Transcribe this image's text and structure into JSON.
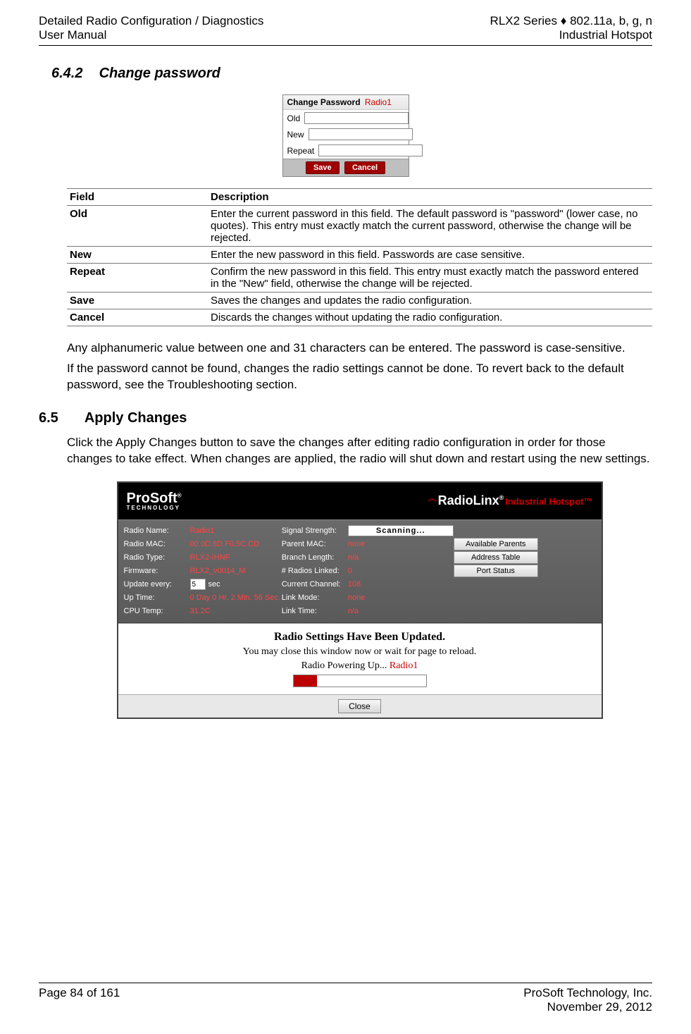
{
  "header": {
    "left_top": "Detailed Radio Configuration / Diagnostics",
    "left_bottom": "User Manual",
    "right_top": "RLX2 Series ♦ 802.11a, b, g, n",
    "right_bottom": "Industrial Hotspot"
  },
  "section_642": {
    "number": "6.4.2",
    "title": "Change password",
    "dialog": {
      "title": "Change Password",
      "radio_name": "Radio1",
      "rows": {
        "old": "Old",
        "new": "New",
        "repeat": "Repeat"
      },
      "buttons": {
        "save": "Save",
        "cancel": "Cancel"
      }
    },
    "table": {
      "head_field": "Field",
      "head_desc": "Description",
      "rows": [
        {
          "field": "Old",
          "desc": "Enter the current password in this field. The default password is \"password\" (lower case, no quotes). This entry must exactly match the current password, otherwise the change will be rejected."
        },
        {
          "field": "New",
          "desc": "Enter the new password in this field. Passwords are case sensitive."
        },
        {
          "field": "Repeat",
          "desc": "Confirm the new password in this field. This entry must exactly match the password entered in the \"New\" field, otherwise the change will be rejected."
        },
        {
          "field": "Save",
          "desc": "Saves the changes and updates the radio configuration."
        },
        {
          "field": "Cancel",
          "desc": "Discards the changes without updating the radio configuration."
        }
      ]
    },
    "para1": "Any alphanumeric value between one and 31 characters can be entered. The password is case-sensitive.",
    "para2": "If the password cannot be found, changes the radio settings cannot be done. To revert back to the default password, see the Troubleshooting section."
  },
  "section_65": {
    "number": "6.5",
    "title": "Apply Changes",
    "para": "Click the Apply Changes button to save the changes after editing radio configuration in order for those changes to take effect. When changes are applied, the radio will shut down and restart using the new settings.",
    "panel": {
      "logo": "ProSoft",
      "logo_sub": "TECHNOLOGY",
      "brand": "RadioLinx",
      "brand_tag": "Industrial Hotspot™",
      "col1": [
        {
          "label": "Radio Name:",
          "value": "Radio1"
        },
        {
          "label": "Radio MAC:",
          "value": "00.0D.8D.F0.5C.CD"
        },
        {
          "label": "Radio Type:",
          "value": "RLX2-IHNF"
        },
        {
          "label": "Firmware:",
          "value": "RLX2_v0014_M"
        },
        {
          "label": "Update every:",
          "value": "5",
          "suffix": "sec",
          "input": true
        },
        {
          "label": "Up Time:",
          "value": "0 Day 0 Hr. 2 Min. 56 Sec."
        },
        {
          "label": "CPU Temp:",
          "value": "31.2C"
        }
      ],
      "col2": [
        {
          "label": "Signal Strength:",
          "scan": "Scanning..."
        },
        {
          "label": "Parent MAC:",
          "value": "none"
        },
        {
          "label": "Branch Length:",
          "value": "n/a"
        },
        {
          "label": "# Radios Linked:",
          "value": "0"
        },
        {
          "label": "Current Channel:",
          "value": "108"
        },
        {
          "label": "Link Mode:",
          "value": "none"
        },
        {
          "label": "Link Time:",
          "value": "n/a"
        }
      ],
      "col3_buttons": [
        "Available Parents",
        "Address Table",
        "Port Status"
      ],
      "msg_title": "Radio Settings Have Been Updated.",
      "msg_sub": "You may close this window now or wait for page to reload.",
      "msg_power": "Radio Powering Up...",
      "msg_radio": "Radio1",
      "close": "Close"
    }
  },
  "footer": {
    "left": "Page 84 of 161",
    "right_top": "ProSoft Technology, Inc.",
    "right_bottom": "November 29, 2012"
  }
}
